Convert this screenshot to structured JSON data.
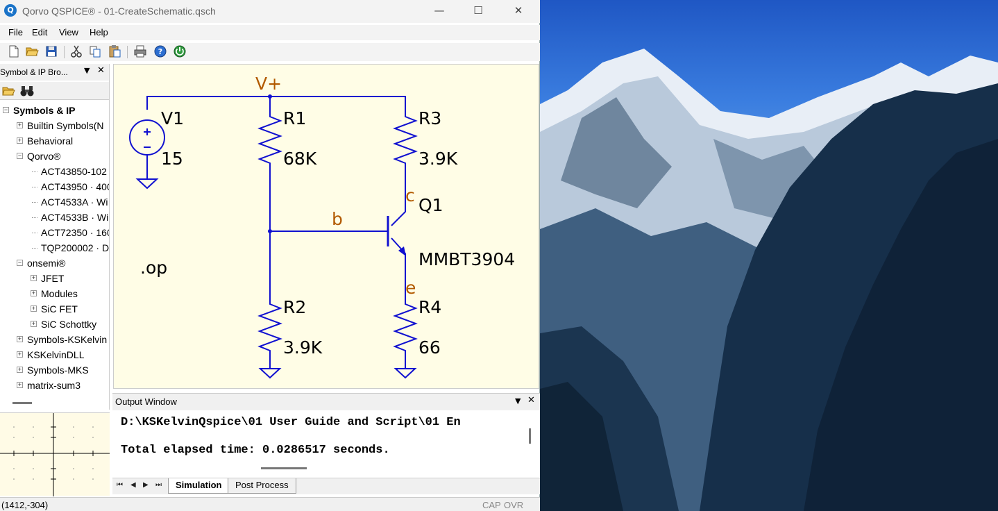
{
  "window": {
    "title": "Qorvo QSPICE® - 01-CreateSchematic.qsch",
    "app_icon_glyph": "Q",
    "minimize_glyph": "—",
    "maximize_glyph": "☐",
    "close_glyph": "✕"
  },
  "menu": [
    "File",
    "Edit",
    "View",
    "Help"
  ],
  "toolbar": [
    "new-file-icon",
    "open-folder-icon",
    "save-icon",
    "cut-icon",
    "copy-icon",
    "paste-icon",
    "print-icon",
    "help-icon",
    "run-icon"
  ],
  "browser": {
    "title": "Symbol & IP Bro...",
    "pin_glyph": "▼",
    "close_glyph": "✕",
    "tree": [
      {
        "label": "Symbols & IP",
        "level": 0,
        "box": "−",
        "bold": true
      },
      {
        "label": "Builtin Symbols(N",
        "level": 1,
        "box": "+"
      },
      {
        "label": "Behavioral",
        "level": 1,
        "box": "+"
      },
      {
        "label": "Qorvo®",
        "level": 1,
        "box": "−"
      },
      {
        "label": "ACT43850-102",
        "level": 2,
        "box": ""
      },
      {
        "label": "ACT43950 · 400",
        "level": 2,
        "box": ""
      },
      {
        "label": "ACT4533A · Wi",
        "level": 2,
        "box": ""
      },
      {
        "label": "ACT4533B · Wi",
        "level": 2,
        "box": ""
      },
      {
        "label": "ACT72350 · 160",
        "level": 2,
        "box": ""
      },
      {
        "label": "TQP200002 · D",
        "level": 2,
        "box": ""
      },
      {
        "label": "onsemi®",
        "level": 1,
        "box": "−"
      },
      {
        "label": "JFET",
        "level": 2,
        "box": "+"
      },
      {
        "label": "Modules",
        "level": 2,
        "box": "+"
      },
      {
        "label": "SiC FET",
        "level": 2,
        "box": "+"
      },
      {
        "label": "SiC Schottky",
        "level": 2,
        "box": "+"
      },
      {
        "label": "Symbols-KSKelvin",
        "level": 1,
        "box": "+"
      },
      {
        "label": "KSKelvinDLL",
        "level": 1,
        "box": "+"
      },
      {
        "label": "Symbols-MKS",
        "level": 1,
        "box": "+"
      },
      {
        "label": "matrix-sum3",
        "level": 1,
        "box": "+"
      }
    ]
  },
  "schematic": {
    "v1_name": "V1",
    "v1_value": "15",
    "r1_name": "R1",
    "r1_value": "68K",
    "r2_name": "R2",
    "r2_value": "3.9K",
    "r3_name": "R3",
    "r3_value": "3.9K",
    "r4_name": "R4",
    "r4_value": "66",
    "q1_name": "Q1",
    "q1_model": "MMBT3904",
    "net_vplus": "V+",
    "net_b": "b",
    "net_c": "c",
    "net_e": "e",
    "directive": ".op",
    "wire_color": "#1010d0",
    "net_label_color": "#b25a00"
  },
  "output": {
    "title": "Output Window",
    "pin_glyph": "▼",
    "close_glyph": "✕",
    "lines": [
      "D:\\KSKelvinQspice\\01 User Guide and Script\\01 En",
      "Total elapsed time: 0.0286517 seconds."
    ]
  },
  "tabs": {
    "nav": [
      "⏮",
      "◀",
      "▶",
      "⏭"
    ],
    "items": [
      {
        "label": "Simulation",
        "active": true
      },
      {
        "label": "Post Process",
        "active": false
      }
    ]
  },
  "status": {
    "coords": "(1412,-304)",
    "cap": "CAP",
    "ovr": "OVR"
  }
}
